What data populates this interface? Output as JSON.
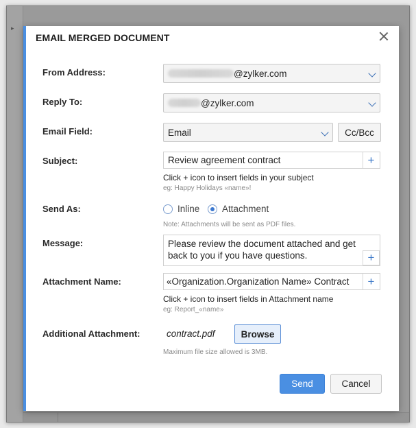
{
  "dialog": {
    "title": "EMAIL MERGED DOCUMENT"
  },
  "from_address": {
    "label": "From Address:",
    "value_suffix": "@zylker.com"
  },
  "reply_to": {
    "label": "Reply To:",
    "value_suffix": "@zylker.com"
  },
  "email_field": {
    "label": "Email Field:",
    "value": "Email",
    "cc_bcc_label": "Cc/Bcc"
  },
  "subject": {
    "label": "Subject:",
    "value": "Review agreement contract",
    "hint": "Click + icon to insert fields in your subject",
    "example": "eg: Happy Holidays «name»!"
  },
  "send_as": {
    "label": "Send As:",
    "options": [
      {
        "label": "Inline",
        "checked": false
      },
      {
        "label": "Attachment",
        "checked": true
      }
    ],
    "note": "Note: Attachments will be sent as PDF files."
  },
  "message": {
    "label": "Message:",
    "value": "Please review the document attached and get back to you if you have questions."
  },
  "attachment_name": {
    "label": "Attachment Name:",
    "value": "«Organization.Organization Name» Contract",
    "hint": "Click + icon to insert fields in Attachment name",
    "example": "eg: Report_«name»"
  },
  "additional_attachment": {
    "label": "Additional Attachment:",
    "file_name": "contract.pdf",
    "browse_label": "Browse",
    "note": "Maximum file size allowed is 3MB."
  },
  "footer": {
    "send_label": "Send",
    "cancel_label": "Cancel"
  },
  "icons": {
    "plus": "+"
  },
  "colors": {
    "accent": "#4a8fe2",
    "plus_icon": "#3c78c8"
  }
}
